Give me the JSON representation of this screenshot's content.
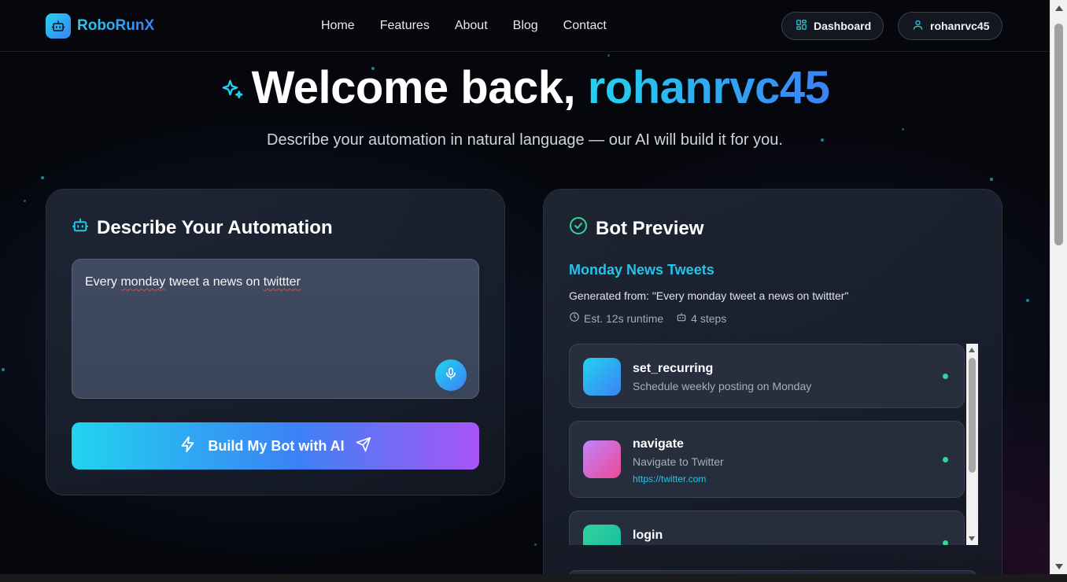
{
  "brand": {
    "name": "RoboRunX",
    "accent": "#22d3ee",
    "accent2": "#3b82f6"
  },
  "nav": {
    "links": [
      "Home",
      "Features",
      "About",
      "Blog",
      "Contact"
    ],
    "dashboard_label": "Dashboard",
    "user_label": "rohanrvc45"
  },
  "hero": {
    "title_prefix": "Welcome back, ",
    "username": "rohanrvc45",
    "subtitle": "Describe your automation in natural language — our AI will build it for you."
  },
  "describe": {
    "heading": "Describe Your Automation",
    "input_words": [
      "Every ",
      "monday",
      " tweet a news on ",
      "twittter"
    ],
    "build_label": "Build My Bot with AI"
  },
  "preview": {
    "heading": "Bot Preview",
    "bot_name": "Monday News Tweets",
    "generated_from": "Generated from: \"Every monday tweet a news on twittter\"",
    "runtime": "Est. 12s runtime",
    "steps_count": "4 steps",
    "steps": [
      {
        "title": "set_recurring",
        "desc": "Schedule weekly posting on Monday",
        "url": "",
        "icon": "gradient-cyan-blue",
        "status_color": "#34d399"
      },
      {
        "title": "navigate",
        "desc": "Navigate to Twitter",
        "url": "https://twitter.com",
        "icon": "gradient-purple-pink",
        "status_color": "#34d399"
      },
      {
        "title": "login",
        "desc": "",
        "url": "",
        "icon": "gradient-green-teal",
        "status_color": "#34d399"
      }
    ]
  }
}
